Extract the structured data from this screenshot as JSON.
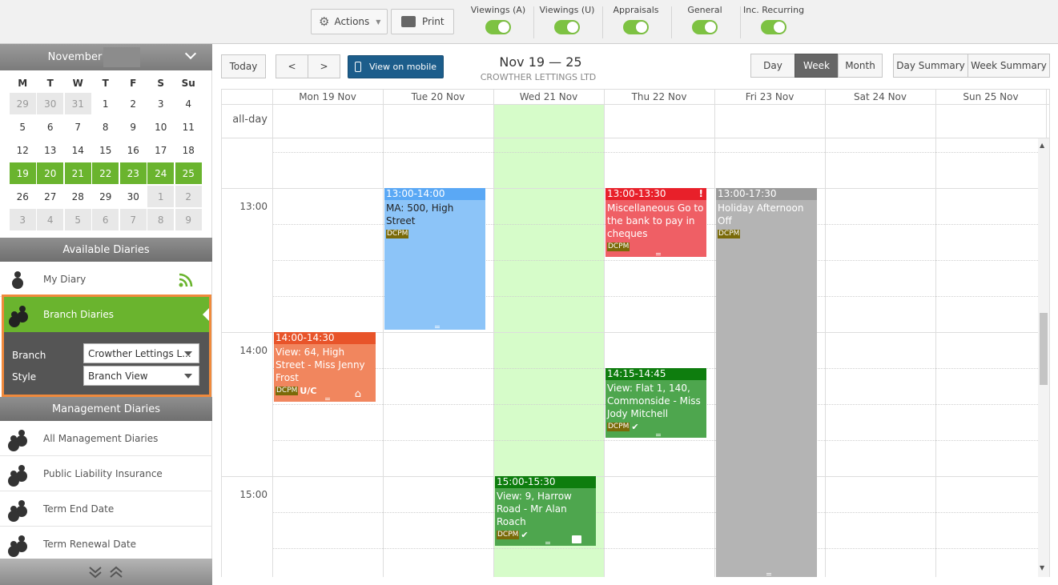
{
  "toolbar": {
    "actions_label": "Actions",
    "print_label": "Print",
    "toggles": [
      {
        "label": "Viewings (A)",
        "on": true
      },
      {
        "label": "Viewings (U)",
        "on": true
      },
      {
        "label": "Appraisals",
        "on": true
      },
      {
        "label": "General",
        "on": true
      },
      {
        "label": "Inc. Recurring",
        "on": true
      }
    ],
    "accent": "#7dc242"
  },
  "mini_calendar": {
    "month_label": "November",
    "weekdays": [
      "M",
      "T",
      "W",
      "T",
      "F",
      "S",
      "Su"
    ],
    "weeks": [
      [
        "29",
        "30",
        "31",
        "1",
        "2",
        "3",
        "4"
      ],
      [
        "5",
        "6",
        "7",
        "8",
        "9",
        "10",
        "11"
      ],
      [
        "12",
        "13",
        "14",
        "15",
        "16",
        "17",
        "18"
      ],
      [
        "19",
        "20",
        "21",
        "22",
        "23",
        "24",
        "25"
      ],
      [
        "26",
        "27",
        "28",
        "29",
        "30",
        "1",
        "2"
      ],
      [
        "3",
        "4",
        "5",
        "6",
        "7",
        "8",
        "9"
      ]
    ],
    "selected_color": "#6ab42e"
  },
  "sidebar": {
    "available_title": "Available Diaries",
    "my_diary": "My Diary",
    "branch_diaries": "Branch Diaries",
    "branch_label": "Branch",
    "branch_value": "Crowther Lettings L...",
    "style_label": "Style",
    "style_value": "Branch View",
    "management_title": "Management Diaries",
    "management_items": [
      "All Management Diaries",
      "Public Liability Insurance",
      "Term End Date",
      "Term Renewal Date"
    ]
  },
  "calendar": {
    "today_label": "Today",
    "prev_label": "<",
    "next_label": ">",
    "mobile_label": "View on mobile",
    "range_title": "Nov 19 — 25",
    "company": "CROWTHER LETTINGS LTD",
    "views": {
      "day": "Day",
      "week": "Week",
      "month": "Month"
    },
    "summaries": {
      "day": "Day Summary",
      "week": "Week Summary"
    },
    "allday_label": "all-day",
    "days": [
      "Mon 19 Nov",
      "Tue 20 Nov",
      "Wed 21 Nov",
      "Thu 22 Nov",
      "Fri 23 Nov",
      "Sat 24 Nov",
      "Sun 25 Nov"
    ],
    "times": [
      "13:00",
      "14:00",
      "15:00"
    ],
    "today_color": "#d6fcc9"
  },
  "events": [
    {
      "time": "13:00-14:00",
      "body": "MA: 500, High Street",
      "tag": "DCPM",
      "header_color": "#5aa8f5",
      "body_color": "#8cc4f8"
    },
    {
      "time": "13:00-13:30",
      "body": "Miscellaneous Go to the bank to pay in cheques",
      "tag": "DCPM",
      "header_color": "#e8202a",
      "body_color": "#ef5f65",
      "flag": "!"
    },
    {
      "time": "13:00-17:30",
      "body": "Holiday Afternoon Off",
      "tag": "DCPM",
      "header_color": "#9a9a9a",
      "body_color": "#b4b4b4"
    },
    {
      "time": "14:00-14:30",
      "body": "View: 64, High Street - Miss Jenny Frost",
      "tag": "DCPM",
      "extra": "U/C",
      "header_color": "#e8542a",
      "body_color": "#f1865e"
    },
    {
      "time": "14:15-14:45",
      "body": "View: Flat 1, 140, Commonside - Miss Jody Mitchell",
      "tag": "DCPM",
      "header_color": "#0e7d0e",
      "body_color": "#4ea64e"
    },
    {
      "time": "15:00-15:30",
      "body": "View: 9, Harrow Road - Mr Alan Roach",
      "tag": "DCPM",
      "header_color": "#0e7d0e",
      "body_color": "#4ea64e"
    }
  ]
}
